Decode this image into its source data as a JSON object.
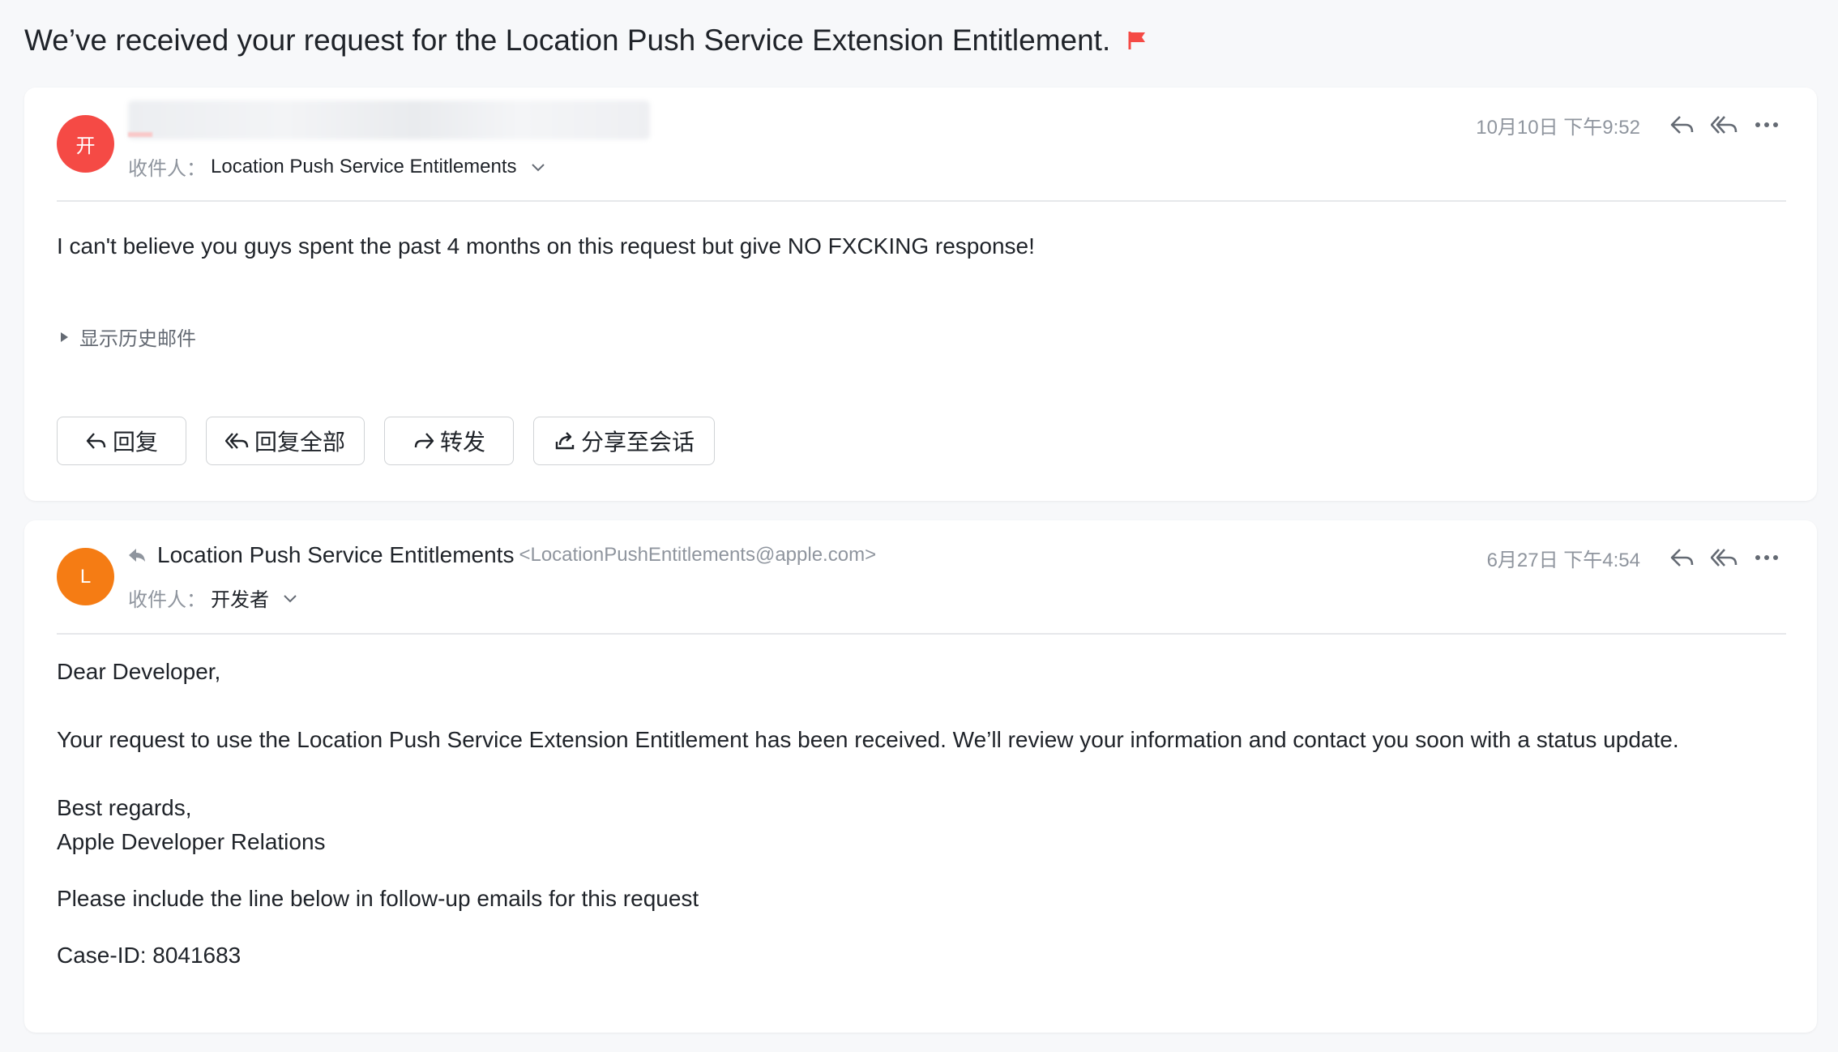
{
  "subject": "We’ve received your request for the Location Push Service Extension Entitlement.",
  "flag_color": "#f54a45",
  "messages": [
    {
      "avatar_initial": "开",
      "avatar_color": "#f54a45",
      "to_label": "收件人：",
      "to_value": "Location Push Service Entitlements",
      "time": "10月10日 下午9:52",
      "body": "I can't believe you guys spent the past 4 months on this request but give NO FXCKING response!",
      "show_history": "显示历史邮件",
      "actions": {
        "reply": "回复",
        "reply_all": "回复全部",
        "forward": "转发",
        "share": "分享至会话"
      }
    },
    {
      "avatar_initial": "L",
      "avatar_color": "#f57c14",
      "sender_name": "Location Push Service Entitlements",
      "sender_email": "<LocationPushEntitlements@apple.com>",
      "to_label": "收件人：",
      "to_value": "开发者",
      "time": "6月27日 下午4:54",
      "body_lines": [
        "Dear Developer,",
        "Your request to use the Location Push Service Extension Entitlement has been received. We’ll review your information and contact you soon with a status update.",
        "Best regards,",
        "Apple Developer Relations",
        "Please include the line below in follow-up emails for this request",
        "Case-ID: 8041683"
      ]
    }
  ],
  "icons": [
    "flag-icon",
    "reply-icon",
    "reply-all-icon",
    "more-icon",
    "chevron-down-icon",
    "triangle-right-icon",
    "forward-icon",
    "share-icon",
    "replied-indicator-icon"
  ]
}
